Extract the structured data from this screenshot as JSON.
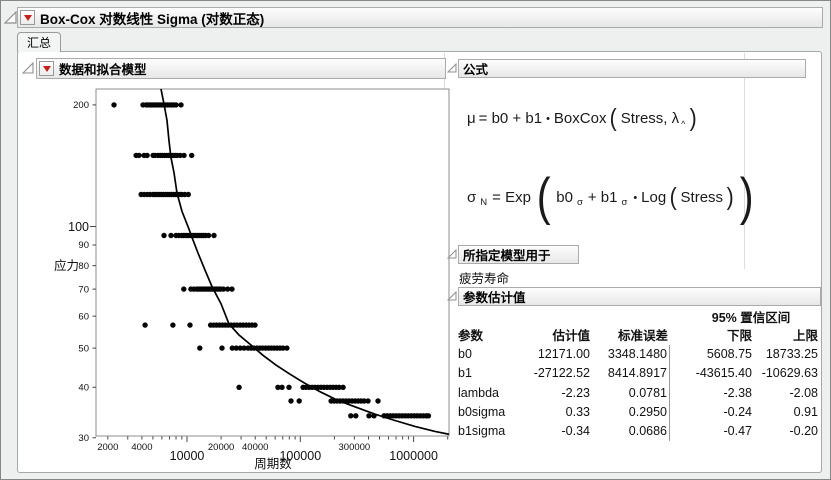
{
  "window": {
    "title": "Box-Cox 对数线性 Sigma (对数正态)",
    "tab": "汇总"
  },
  "sections": {
    "plot": {
      "title": "数据和拟合模型"
    },
    "formula": {
      "title": "公式"
    },
    "model_for": {
      "title": "所指定模型用于",
      "value": "疲劳寿命"
    },
    "estimates": {
      "title": "参数估计值"
    }
  },
  "formulas": {
    "mu": {
      "lhs": "μ",
      "mid": "= b0 + b1",
      "dot": "•",
      "fn": "BoxCox",
      "arg": "Stress, λ",
      "hat": "^",
      "open": "(",
      "close": ")"
    },
    "sigma": {
      "lhs": "σ",
      "sub": "N",
      "mid": "= Exp",
      "b0": "b0",
      "s1": "σ",
      "plus": "+ b1",
      "s2": "σ",
      "dot": "•",
      "fn": "Log",
      "arg": "Stress",
      "open": "(",
      "close": ")"
    }
  },
  "estimates_table": {
    "ci_header": "95% 置信区间",
    "columns": [
      "参数",
      "估计值",
      "标准误差",
      "下限",
      "上限"
    ],
    "rows": [
      [
        "b0",
        "12171.00",
        "3348.1480",
        "5608.75",
        "18733.25"
      ],
      [
        "b1",
        "-27122.52",
        "8414.8917",
        "-43615.40",
        "-10629.63"
      ],
      [
        "lambda",
        "-2.23",
        "0.0781",
        "-2.38",
        "-2.08"
      ],
      [
        "b0sigma",
        "0.33",
        "0.2950",
        "-0.24",
        "0.91"
      ],
      [
        "b1sigma",
        "-0.34",
        "0.0686",
        "-0.47",
        "-0.20"
      ]
    ]
  },
  "icons": {
    "disclosure": "open-triangle-outline",
    "red_menu": "red-triangle-down"
  },
  "chart_data": {
    "type": "scatter",
    "title": "数据和拟合模型",
    "xlabel": "周期数",
    "ylabel": "应力",
    "x_scale": "log",
    "y_scale": "log",
    "grid": false,
    "xlim": [
      1573,
      2053000
    ],
    "ylim": [
      30.3,
      219
    ],
    "x_ticks": [
      {
        "value": 2000,
        "label": "2000",
        "major": false
      },
      {
        "value": 4000,
        "label": "4000",
        "major": false
      },
      {
        "value": 10000,
        "label": "10000",
        "major": true
      },
      {
        "value": 20000,
        "label": "20000",
        "major": false
      },
      {
        "value": 40000,
        "label": "40000",
        "major": false
      },
      {
        "value": 100000,
        "label": "100000",
        "major": true
      },
      {
        "value": 300000,
        "label": "300000",
        "major": false
      },
      {
        "value": 1000000,
        "label": "1000000",
        "major": true
      }
    ],
    "x_minor_ticks": [
      2000,
      3000,
      4000,
      5000,
      6000,
      7000,
      8000,
      9000,
      10000,
      20000,
      30000,
      40000,
      50000,
      60000,
      70000,
      80000,
      90000,
      100000,
      200000,
      300000,
      400000,
      500000,
      600000,
      700000,
      800000,
      900000,
      1000000,
      2000000
    ],
    "y_ticks": [
      {
        "value": 200,
        "label": "200",
        "major": false
      },
      {
        "value": 100,
        "label": "100",
        "major": true
      },
      {
        "value": 90,
        "label": "90",
        "major": false
      },
      {
        "value": 80,
        "label": "80",
        "major": false
      },
      {
        "value": 70,
        "label": "70",
        "major": false
      },
      {
        "value": 60,
        "label": "60",
        "major": false
      },
      {
        "value": 50,
        "label": "50",
        "major": false
      },
      {
        "value": 40,
        "label": "40",
        "major": false
      },
      {
        "value": 30,
        "label": "30",
        "major": false
      }
    ],
    "bands": [
      {
        "stress": 200,
        "cycles": [
          2270,
          4090,
          4350,
          4530,
          4710,
          4900,
          5100,
          5310,
          5520,
          5750,
          5980,
          6230,
          6480,
          6740,
          7020,
          7300,
          7600,
          8000,
          8850
        ]
      },
      {
        "stress": 150,
        "cycles": [
          3550,
          3770,
          4180,
          4440,
          5020,
          5230,
          5550,
          5800,
          6050,
          6320,
          6600,
          6890,
          7200,
          7520,
          7850,
          8200,
          8700,
          9400,
          11000
        ]
      },
      {
        "stress": 120,
        "cycles": [
          3930,
          4180,
          4440,
          4710,
          5020,
          5230,
          5450,
          5690,
          5930,
          6180,
          6450,
          6720,
          7010,
          7310,
          7620,
          7940,
          8280,
          8630,
          9000,
          9560,
          10260
        ]
      },
      {
        "stress": 95,
        "cycles": [
          6270,
          7220,
          7990,
          8480,
          9000,
          9370,
          9750,
          10200,
          10620,
          11050,
          11500,
          11970,
          12460,
          12970,
          13500,
          14050,
          14620,
          15520,
          17300
        ]
      },
      {
        "stress": 70,
        "cycles": [
          9370,
          10830,
          11500,
          12210,
          12710,
          13230,
          13770,
          14330,
          14920,
          15530,
          16160,
          16820,
          17510,
          18220,
          18970,
          19740,
          20960,
          22870,
          24950
        ]
      },
      {
        "stress": 57,
        "cycles": [
          4270,
          7500,
          10620,
          16160,
          17170,
          18220,
          19350,
          20550,
          21820,
          23170,
          24600,
          26130,
          27740,
          29460,
          31280,
          33220,
          35280,
          37460,
          39780
        ]
      },
      {
        "stress": 50,
        "cycles": [
          12970,
          20350,
          25100,
          27180,
          29460,
          31920,
          34590,
          36700,
          38940,
          41320,
          43840,
          46510,
          49350,
          52360,
          55560,
          58950,
          62540,
          66360,
          70400,
          76100
        ]
      },
      {
        "stress": 40,
        "cycles": [
          28800,
          63400,
          68900,
          79400,
          105900,
          112500,
          119600,
          127100,
          135100,
          143600,
          152600,
          162200,
          172400,
          183200,
          194700,
          206900,
          219900,
          238800
        ]
      },
      {
        "stress": 37,
        "cycles": [
          82700,
          97800,
          187000,
          198800,
          211300,
          224500,
          238800,
          253700,
          269600,
          286600,
          304600,
          323700,
          344000,
          365600,
          395800,
          484500
        ]
      },
      {
        "stress": 34,
        "cycles": [
          279000,
          308600,
          404000,
          446900,
          549000,
          584000,
          621000,
          660000,
          702000,
          746500,
          793800,
          844100,
          897600,
          954500,
          1015000,
          1079000,
          1148000,
          1220500,
          1298000,
          1352000
        ]
      }
    ],
    "curve": [
      [
        5890,
        219
      ],
      [
        6270,
        201
      ],
      [
        6660,
        183
      ],
      [
        6940,
        163
      ],
      [
        7220,
        148
      ],
      [
        7680,
        136
      ],
      [
        8160,
        121
      ],
      [
        9040,
        109
      ],
      [
        10200,
        100
      ],
      [
        11070,
        94
      ],
      [
        12510,
        86
      ],
      [
        14420,
        78
      ],
      [
        16620,
        71
      ],
      [
        19960,
        64.4
      ],
      [
        23480,
        57.4
      ],
      [
        28770,
        53.9
      ],
      [
        36730,
        50.9
      ],
      [
        46860,
        48
      ],
      [
        61050,
        45.4
      ],
      [
        81130,
        43.1
      ],
      [
        110000,
        40.9
      ],
      [
        152300,
        38.9
      ],
      [
        215200,
        37.1
      ],
      [
        310300,
        35.7
      ],
      [
        456400,
        34.3
      ],
      [
        685300,
        33.1
      ],
      [
        1029000,
        32
      ],
      [
        1545000,
        31.1
      ],
      [
        2053000,
        30.6
      ]
    ]
  }
}
